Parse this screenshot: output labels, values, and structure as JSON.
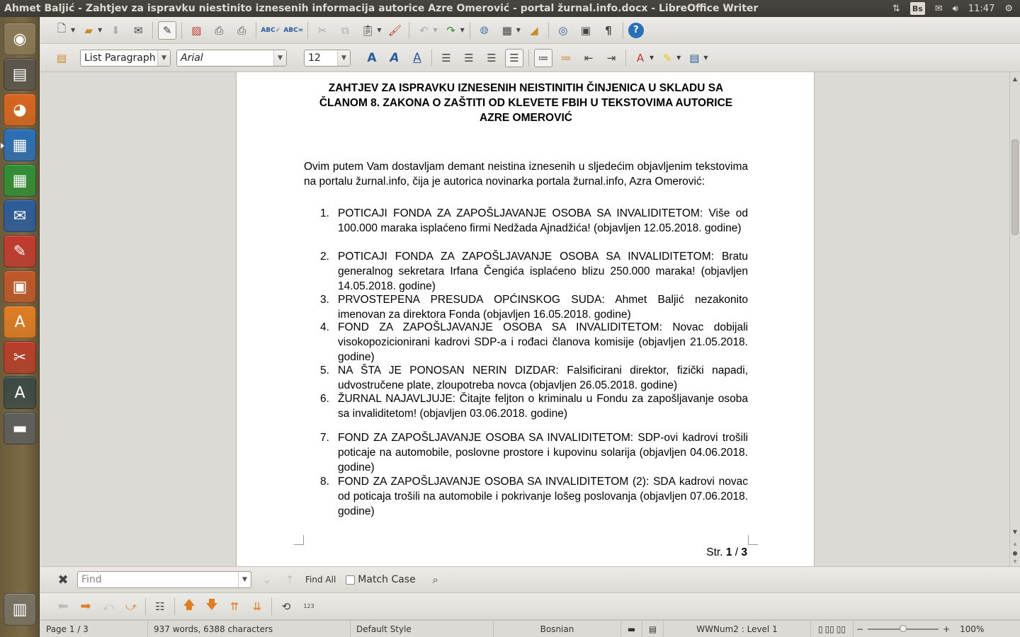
{
  "window": {
    "title": "Ahmet Baljić -   Zahtjev za ispravku niestinito iznesenih informacija autorice Azre Omerović - portal žurnal.info.docx - LibreOffice Writer"
  },
  "indicators": {
    "keyboard_layout": "Bs",
    "clock": "11:47"
  },
  "launcher": {
    "items": [
      {
        "name": "dash-home",
        "icon": "ubuntu-logo-icon",
        "glyph": "◉",
        "color": "#8a7b58"
      },
      {
        "name": "files",
        "icon": "file-cabinet-icon",
        "glyph": "▤",
        "color": "#5a554c"
      },
      {
        "name": "firefox",
        "icon": "firefox-icon",
        "glyph": "◕",
        "color": "#d9651f"
      },
      {
        "name": "writer",
        "icon": "writer-icon",
        "glyph": "▦",
        "color": "#2a6fb8"
      },
      {
        "name": "calc",
        "icon": "calc-icon",
        "glyph": "▦",
        "color": "#2f8f35"
      },
      {
        "name": "thunderbird",
        "icon": "thunderbird-icon",
        "glyph": "✉",
        "color": "#2a5c9c"
      },
      {
        "name": "document-viewer",
        "icon": "document-viewer-icon",
        "glyph": "✎",
        "color": "#c23a2f"
      },
      {
        "name": "impress",
        "icon": "impress-icon",
        "glyph": "▣",
        "color": "#c0582a"
      },
      {
        "name": "software-center",
        "icon": "software-center-icon",
        "glyph": "A",
        "color": "#e07d22"
      },
      {
        "name": "system-settings",
        "icon": "settings-wrench-icon",
        "glyph": "✂",
        "color": "#b83d2a"
      },
      {
        "name": "software-updater",
        "icon": "updater-icon",
        "glyph": "A",
        "color": "#3a4a46"
      },
      {
        "name": "save-drive",
        "icon": "floppy-disk-icon",
        "glyph": "▬",
        "color": "#5e5e5e"
      },
      {
        "name": "trash",
        "icon": "trash-icon",
        "glyph": "▥",
        "color": "#787266"
      }
    ]
  },
  "format_toolbar": {
    "paragraph_style": "List Paragraph",
    "font_name": "Arial",
    "font_size": "12"
  },
  "document": {
    "title": "ZAHTJEV ZA ISPRAVKU IZNESENIH NEISTINITIH ČINJENICA U SKLADU SA ČLANOM 8. ZAKONA O ZAŠTITI OD KLEVETE FBIH U TEKSTOVIMA AUTORICE AZRE OMEROVIĆ",
    "intro": "Ovim putem Vam dostavljam demant neistina iznesenih u sljedećim objavljenim tekstovima na portalu žurnal.info, čija je autorica novinarka portala žurnal.info, Azra Omerović:",
    "items": [
      {
        "num": "1.",
        "text": "POTICAJI FONDA ZA ZAPOŠLJAVANJE OSOBA SA INVALIDITETOM: Više od 100.000 maraka isplaćeno firmi Nedžada Ajnadžića! (objavljen 12.05.2018. godine)"
      },
      {
        "num": "2.",
        "text": "POTICAJI FONDA ZA ZAPOŠLJAVANJE OSOBA SA INVALIDITETOM: Bratu generalnog sekretara Irfana Čengića isplaćeno blizu 250.000 maraka! (objavljen 14.05.2018. godine)"
      },
      {
        "num": "3.",
        "text": "PRVOSTEPENA PRESUDA OPĆINSKOG SUDA: Ahmet Baljić nezakonito imenovan za direktora Fonda (objavljen 16.05.2018. godine)"
      },
      {
        "num": "4.",
        "text": "FOND ZA ZAPOŠLJAVANJE OSOBA SA INVALIDITETOM: Novac dobijali visokopozicionirani kadrovi SDP-a i rođaci članova komisije (objavljen 21.05.2018. godine)"
      },
      {
        "num": "5.",
        "text": "NA ŠTA JE PONOSAN NERIN DIZDAR: Falsificirani direktor, fizički napadi, udvostručene plate, zloupotreba novca (objavljen 26.05.2018. godine)"
      },
      {
        "num": "6.",
        "text": "ŽURNAL NAJAVLJUJE: Čitajte feljton o kriminalu u Fondu za zapošljavanje osoba sa invaliditetom! (objavljen 03.06.2018. godine)"
      },
      {
        "num": "7.",
        "text": "FOND ZA ZAPOŠLJAVANJE OSOBA SA INVALIDITETOM: SDP-ovi kadrovi trošili poticaje na automobile, poslovne prostore i kupovinu solarija (objavljen 04.06.2018. godine)"
      },
      {
        "num": "8.",
        "text": "FOND ZA ZAPOŠLJAVANJE OSOBA SA INVALIDITETOM (2): SDA kadrovi novac od poticaja trošili na automobile i pokrivanje lošeg poslovanja (objavljen 07.06.2018. godine)"
      }
    ],
    "footer": {
      "prefix": "Str.",
      "current": "1",
      "separator": "/",
      "total": "3"
    }
  },
  "find_bar": {
    "placeholder": "Find",
    "find_all_label": "Find All",
    "match_case_label": "Match Case"
  },
  "status_bar": {
    "page": "Page 1 / 3",
    "word_count": "937 words, 6388 characters",
    "page_style": "Default Style",
    "language": "Bosnian",
    "list_level": "WWNum2 : Level 1",
    "zoom": "100%",
    "zoom_level": 100
  },
  "colors": {
    "panel": "#3c3b37",
    "toolbar": "#dcdad5",
    "page": "#ffffff"
  }
}
